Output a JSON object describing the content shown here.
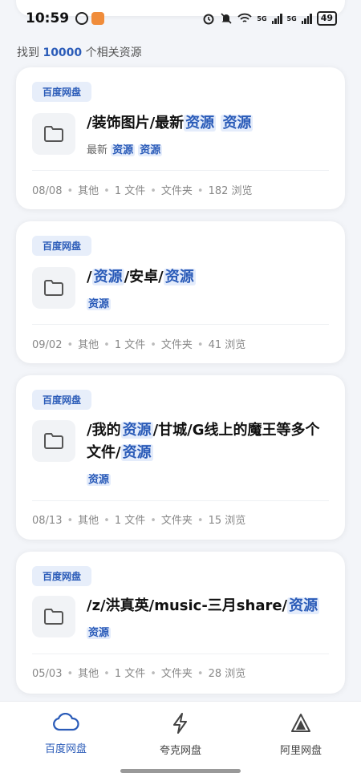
{
  "status_bar": {
    "time": "10:59",
    "battery": "49",
    "net1": "5G",
    "net2": "5G"
  },
  "summary": {
    "prefix": "找到",
    "count": "10000",
    "suffix": "个相关资源"
  },
  "results": [
    {
      "badge": "百度网盘",
      "title": [
        {
          "t": "/装饰图片/最新"
        },
        {
          "t": "资源",
          "hl": true
        },
        {
          "t": " "
        },
        {
          "t": "资源",
          "hl": true
        }
      ],
      "subtitle": [
        {
          "t": "最新 "
        },
        {
          "t": "资源",
          "hl": true
        },
        {
          "t": " "
        },
        {
          "t": "资源",
          "hl": true
        }
      ],
      "meta": [
        "08/08",
        "其他",
        "1 文件",
        "文件夹",
        "182 浏览"
      ]
    },
    {
      "badge": "百度网盘",
      "title": [
        {
          "t": "/"
        },
        {
          "t": "资源",
          "hl": true
        },
        {
          "t": "/安卓/"
        },
        {
          "t": "资源",
          "hl": true
        }
      ],
      "subtitle": [
        {
          "t": "资源",
          "hl": true
        }
      ],
      "meta": [
        "09/02",
        "其他",
        "1 文件",
        "文件夹",
        "41 浏览"
      ]
    },
    {
      "badge": "百度网盘",
      "title": [
        {
          "t": "/我的"
        },
        {
          "t": "资源",
          "hl": true
        },
        {
          "t": "/甘城/G线上的魔王等多个文件/"
        },
        {
          "t": "资源",
          "hl": true
        }
      ],
      "subtitle": [
        {
          "t": "资源",
          "hl": true
        }
      ],
      "meta": [
        "08/13",
        "其他",
        "1 文件",
        "文件夹",
        "15 浏览"
      ]
    },
    {
      "badge": "百度网盘",
      "title": [
        {
          "t": "/z/洪真英/music-三月share/"
        },
        {
          "t": "资源",
          "hl": true
        }
      ],
      "subtitle": [
        {
          "t": "资源",
          "hl": true
        }
      ],
      "meta": [
        "05/03",
        "其他",
        "1 文件",
        "文件夹",
        "28 浏览"
      ]
    }
  ],
  "nav": [
    {
      "label": "百度网盘",
      "icon": "cloud-icon",
      "active": true
    },
    {
      "label": "夸克网盘",
      "icon": "lightning-icon",
      "active": false
    },
    {
      "label": "阿里网盘",
      "icon": "triangle-icon",
      "active": false
    }
  ],
  "colors": {
    "accent": "#2a5bb8",
    "highlight_bg": "#e4ecfb",
    "page_bg": "#f3f5f9"
  }
}
